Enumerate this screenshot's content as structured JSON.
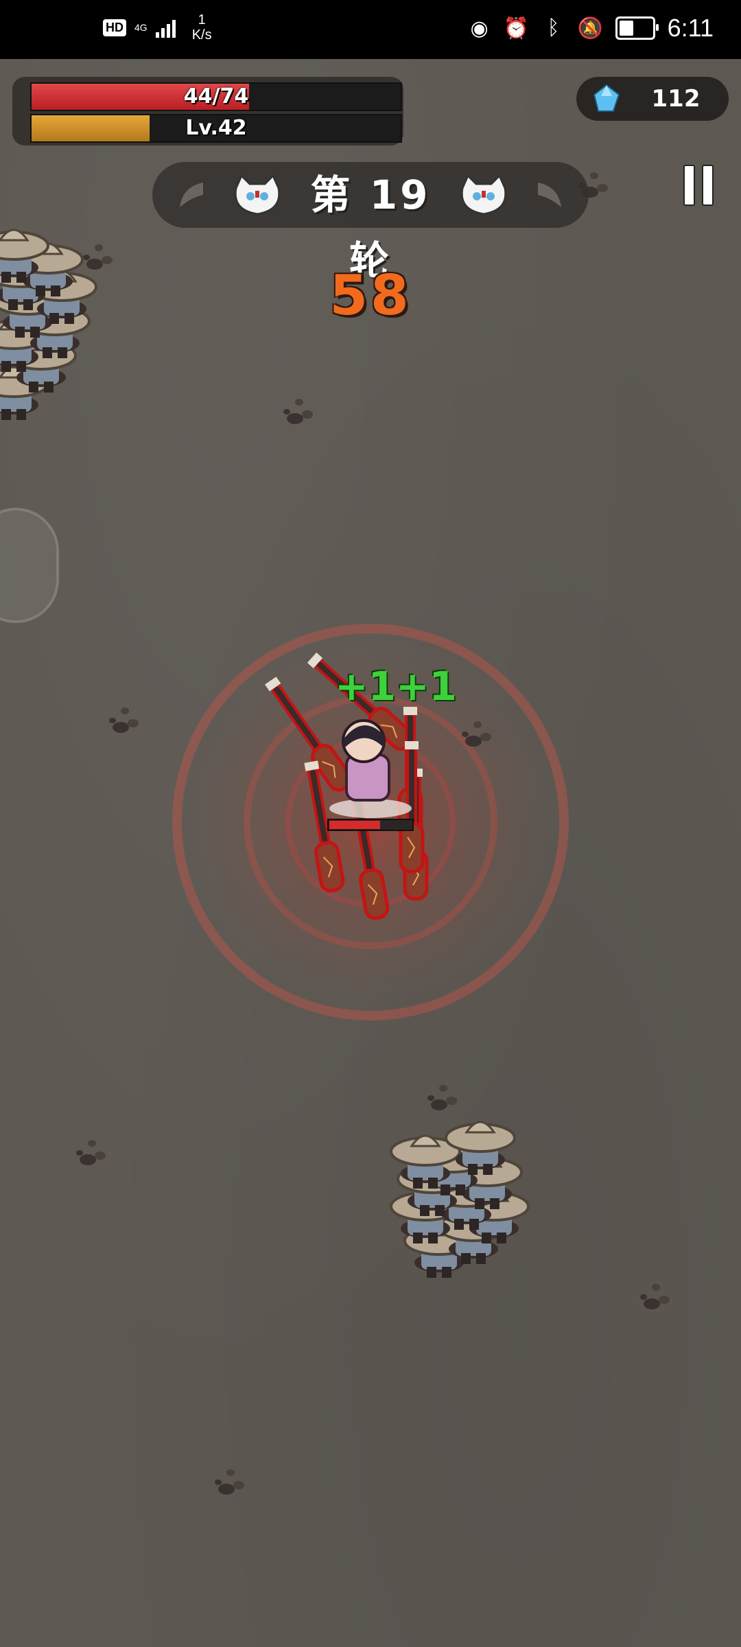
{
  "status_bar": {
    "hd_label": "HD",
    "network_label": "4G",
    "speed_value": "1",
    "speed_unit": "K/s",
    "time": "6:11",
    "icons": [
      "eye-icon",
      "alarm-icon",
      "bluetooth-icon",
      "mute-icon",
      "battery-icon"
    ]
  },
  "hud": {
    "hp_text": "44/74",
    "hp_fraction": 0.59,
    "level_text": "Lv.42",
    "xp_fraction": 0.32,
    "gems": "112",
    "round_title": "第 19 轮",
    "timer": "58",
    "pickup_text": "+1+1"
  },
  "colors": {
    "hp": "#d2302f",
    "xp": "#d39a2d",
    "timer": "#f26a1e",
    "pickup": "#3ed13b"
  }
}
